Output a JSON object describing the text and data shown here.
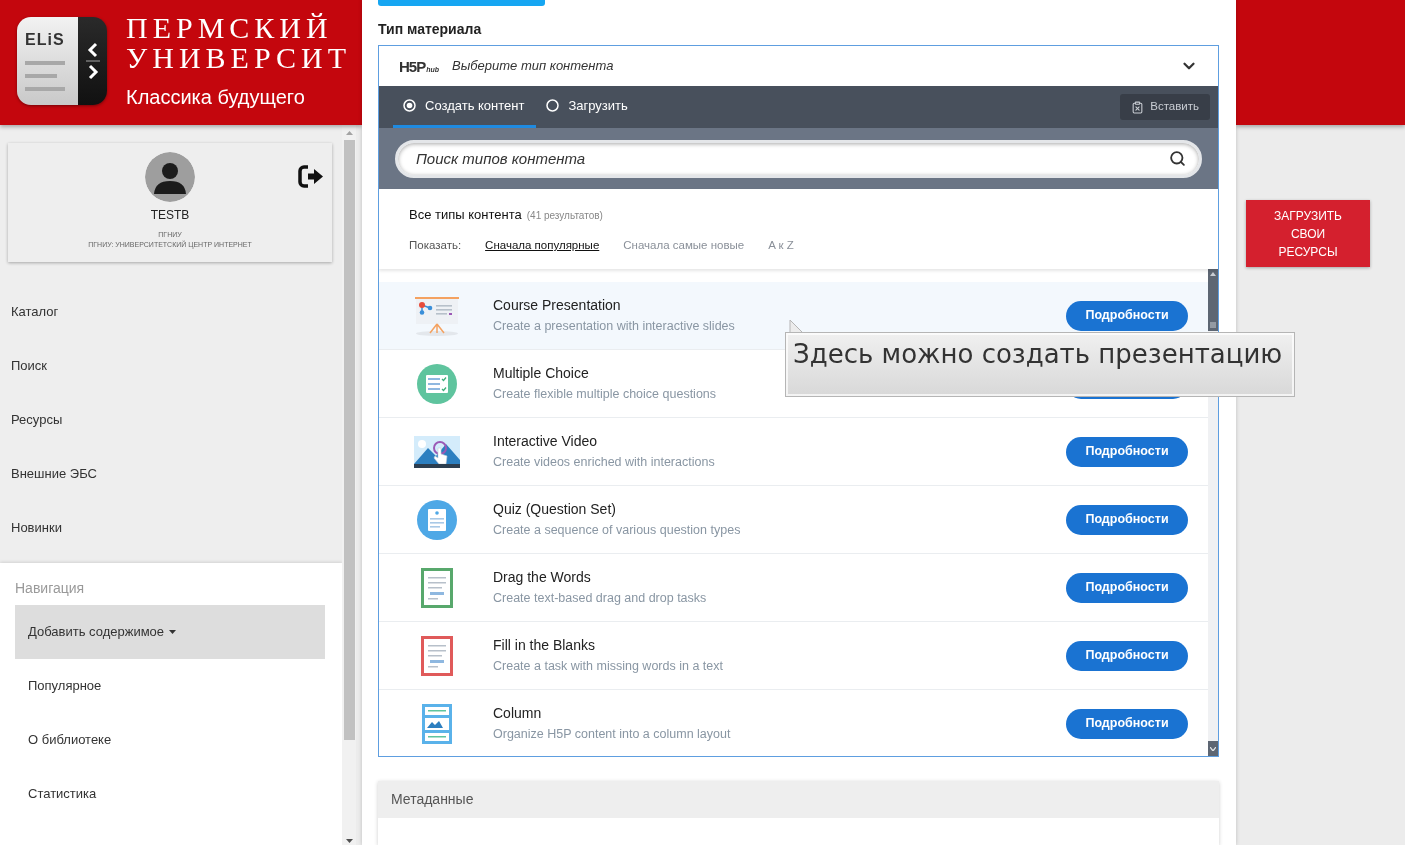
{
  "header": {
    "logo_text": "ELiS",
    "title_lines": [
      "ПЕРМСКИЙ",
      "УНИВЕРСИТ"
    ],
    "tagline": "Классика будущего"
  },
  "profile": {
    "name": "TESTB",
    "organization": "ПГНИУ",
    "department": "ПГНИУ: УНИВЕРСИТЕТСКИЙ ЦЕНТР ИНТЕРНЕТ"
  },
  "sidebar": {
    "items": [
      "Каталог",
      "Поиск",
      "Ресурсы",
      "Внешние ЭБС",
      "Новинки"
    ]
  },
  "navigation": {
    "title": "Навигация",
    "items": [
      {
        "label": "Добавить содержимое",
        "selected": true,
        "dropdown": true
      },
      {
        "label": "Популярное",
        "selected": false,
        "dropdown": false
      },
      {
        "label": "О библиотеке",
        "selected": false,
        "dropdown": false
      },
      {
        "label": "Статистика",
        "selected": false,
        "dropdown": false
      }
    ]
  },
  "form": {
    "field_label": "Тип материала"
  },
  "hub": {
    "logo": "H5P",
    "logo_sub": "hub",
    "title": "Выберите тип контента",
    "tabs": [
      {
        "label": "Создать контент",
        "selected": true
      },
      {
        "label": "Загрузить",
        "selected": false
      }
    ],
    "paste_button": "Вставить",
    "search": {
      "placeholder": "Поиск типов контента"
    },
    "results_title": "Все типы контента",
    "results_count": "(41 результатов)",
    "sort_label": "Показать:",
    "sort_options": [
      {
        "label": "Сначала популярные",
        "selected": true
      },
      {
        "label": "Сначала самые новые",
        "selected": false
      },
      {
        "label": "A к Z",
        "selected": false
      }
    ],
    "items": [
      {
        "kind": "presentation",
        "title": "Course Presentation",
        "description": "Create a presentation with interactive slides",
        "button": "Подробности",
        "hovered": true
      },
      {
        "kind": "choice",
        "title": "Multiple Choice",
        "description": "Create flexible multiple choice questions",
        "hovered": false
      },
      {
        "kind": "video",
        "title": "Interactive Video",
        "description": "Create videos enriched with interactions",
        "button": "Подробности",
        "hovered": false
      },
      {
        "kind": "quiz",
        "title": "Quiz (Question Set)",
        "description": "Create a sequence of various question types",
        "button": "Подробности",
        "hovered": false
      },
      {
        "kind": "drag",
        "title": "Drag the Words",
        "description": "Create text-based drag and drop tasks",
        "button": "Подробности",
        "hovered": false
      },
      {
        "kind": "blanks",
        "title": "Fill in the Blanks",
        "description": "Create a task with missing words in a text",
        "button": "Подробности",
        "hovered": false
      },
      {
        "kind": "column",
        "title": "Column",
        "description": "Organize H5P content into a column layout",
        "button": "Подробности",
        "hovered": false
      }
    ]
  },
  "tooltip": {
    "text": "Здесь можно создать презентацию"
  },
  "metadata": {
    "title": "Метаданные"
  },
  "upload_button": "ЗАГРУЗИТЬ СВОИ РЕСУРСЫ"
}
